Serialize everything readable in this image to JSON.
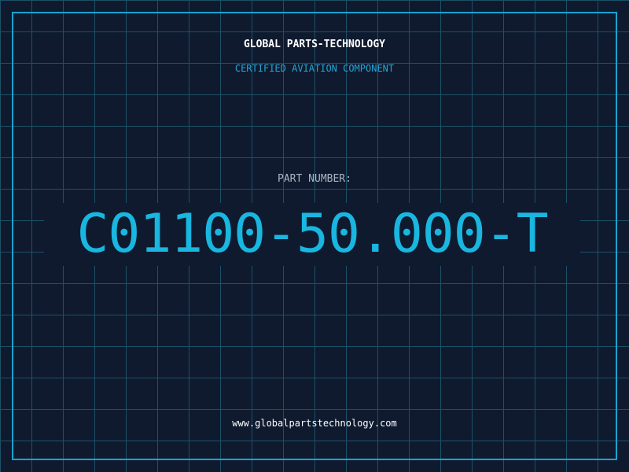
{
  "certificate": {
    "company": "GLOBAL PARTS-TECHNOLOGY",
    "tagline": "CERTIFIED AVIATION COMPONENT",
    "part_label": "PART NUMBER:",
    "part_number": "C01100-50.000-T",
    "website": "www.globalpartstechnology.com"
  },
  "colors": {
    "background": "#0f1a2e",
    "grid": "#1b5167",
    "frame": "#19a3cf",
    "accent": "#19b6e0",
    "text_primary": "#ffffff",
    "text_muted": "#a8b6c6"
  }
}
